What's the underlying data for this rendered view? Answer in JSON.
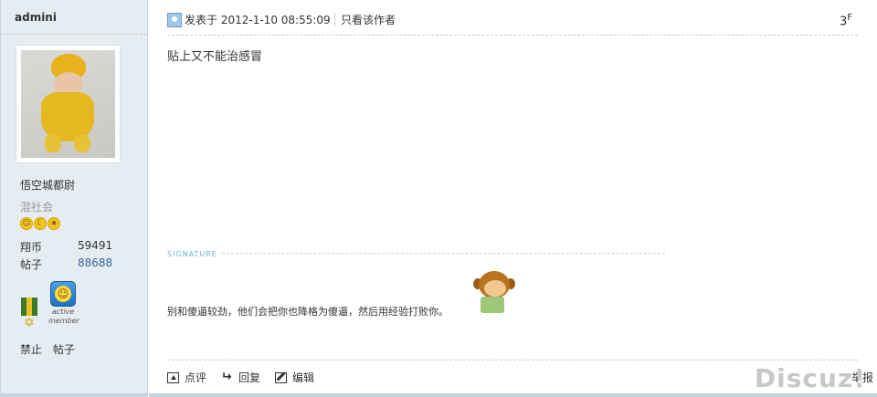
{
  "sidebar": {
    "username": "admini",
    "rank": "悟空城都尉",
    "group": "混社会",
    "stars": [
      "sun-icon",
      "moon-icon",
      "star-icon"
    ],
    "stats": [
      {
        "label": "翔币",
        "value": "59491"
      },
      {
        "label": "帖子",
        "value": "88688"
      }
    ],
    "medal_text": "active\nmember",
    "actions": [
      "禁止",
      "帖子"
    ]
  },
  "post": {
    "posted_prefix": "发表于",
    "posted_time": "2012-1-10 08:55:09",
    "author_only": "只看该作者",
    "floor_num": "3",
    "floor_sup": "F",
    "content": "贴上又不能治感冒",
    "signature_label": "SIGNATURE",
    "signature_text": "别和傻逼较劲，他们会把你也降格为傻逼，然后用经验打败你。"
  },
  "footer": {
    "comment": "点评",
    "reply": "回复",
    "edit": "编辑",
    "report": "举报"
  },
  "watermark": "Discuz!",
  "colors": {
    "sidebar_bg": "#e5edf2",
    "border": "#c2d5e3",
    "link": "#336699"
  }
}
